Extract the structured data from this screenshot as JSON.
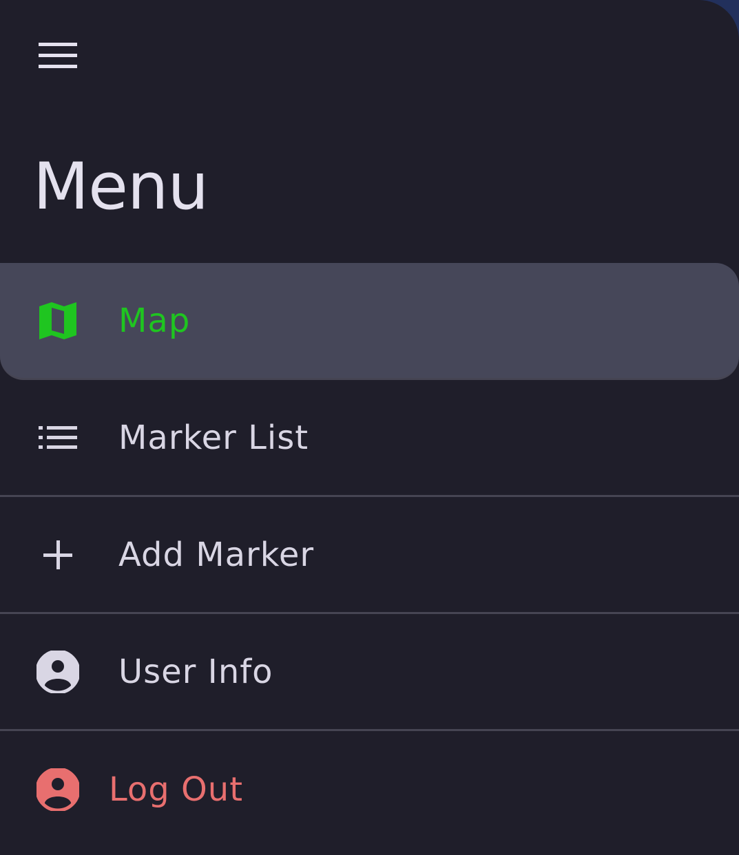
{
  "drawer": {
    "title": "Menu",
    "menu_icon": "hamburger-menu-icon",
    "accent_color": "#1fc520",
    "danger_color": "#e86f6f",
    "items": [
      {
        "label": "Map",
        "icon": "map-icon",
        "active": true
      },
      {
        "label": "Marker List",
        "icon": "list-icon",
        "active": false
      },
      {
        "label": "Add Marker",
        "icon": "plus-icon",
        "active": false
      },
      {
        "label": "User Info",
        "icon": "account-circle-icon",
        "active": false
      },
      {
        "label": "Log Out",
        "icon": "account-circle-icon",
        "active": false
      }
    ]
  }
}
